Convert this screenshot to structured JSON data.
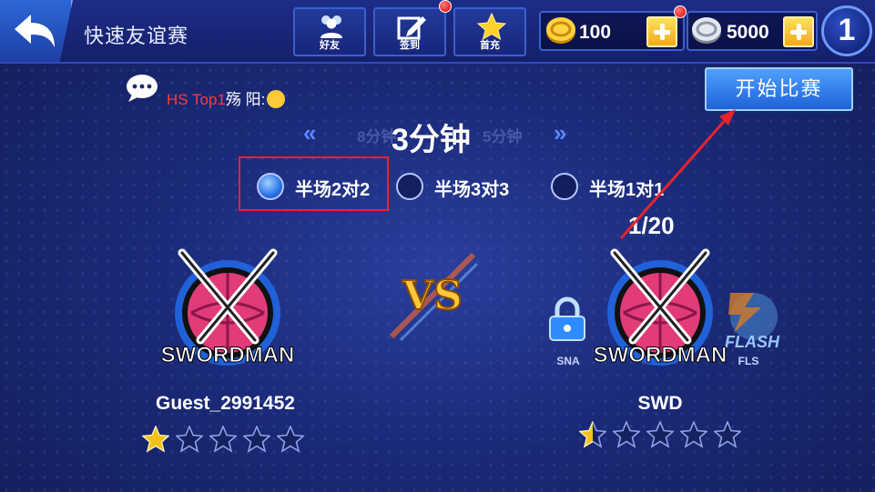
{
  "header": {
    "title": "快速友谊赛",
    "buttons": [
      {
        "label": "好友",
        "icon": "friends-icon"
      },
      {
        "label": "签到",
        "icon": "sign-in-icon"
      },
      {
        "label": "首充",
        "icon": "star-icon"
      }
    ],
    "gold": "100",
    "silver": "5000",
    "level": "1"
  },
  "chat": {
    "user": "HS Top1",
    "message": "殇 阳:"
  },
  "start_button": "开始比赛",
  "time": {
    "prev": "8分钟",
    "current": "3分钟",
    "next": "5分钟",
    "left_arrow": "«",
    "right_arrow": "»"
  },
  "modes": [
    {
      "label": "半场2对2",
      "selected": true
    },
    {
      "label": "半场3对3",
      "selected": false
    },
    {
      "label": "半场1对1",
      "selected": false
    }
  ],
  "opponent_counter": "1/20",
  "home_team": {
    "logo_text": "SWORDMAN",
    "name": "Guest_2991452",
    "rating": 1
  },
  "away_team": {
    "logo_text": "SWORDMAN",
    "name": "SWD",
    "rating": 0.5
  },
  "vs_text": "VS",
  "side_teams": [
    {
      "abbr": "SNA",
      "locked": true
    },
    {
      "abbr": "FLS",
      "logo_text": "FLASH"
    }
  ],
  "colors": {
    "background": "#1b2a78",
    "accent": "#2a72e8",
    "gold": "#f3c21a",
    "ball": "#e23b7a",
    "annotation": "#e8232c"
  }
}
